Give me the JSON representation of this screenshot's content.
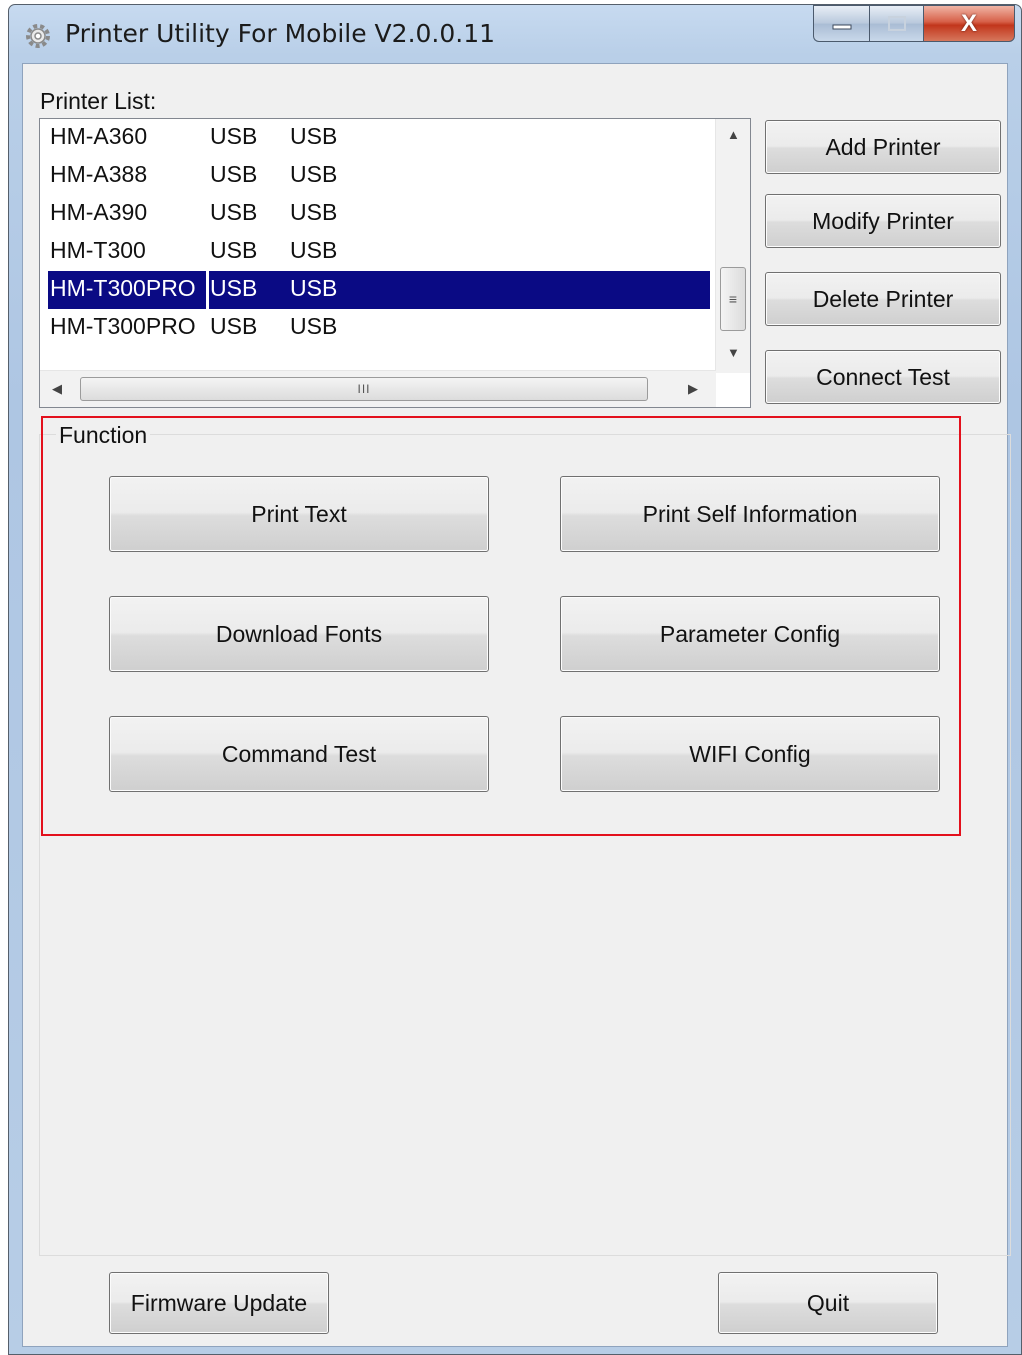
{
  "window": {
    "title": "Printer Utility For Mobile  V2.0.0.11",
    "caption_buttons": {
      "minimize_icon": "minimize-icon",
      "maximize_icon": "maximize-icon",
      "close_label": "X"
    }
  },
  "printer_list": {
    "label": "Printer List:",
    "rows": [
      {
        "name": "HM-A360",
        "col2": "USB",
        "col3": "USB"
      },
      {
        "name": "HM-A388",
        "col2": "USB",
        "col3": "USB"
      },
      {
        "name": "HM-A390",
        "col2": "USB",
        "col3": "USB"
      },
      {
        "name": "HM-T300",
        "col2": "USB",
        "col3": "USB"
      },
      {
        "name": "HM-T300PRO",
        "col2": "USB",
        "col3": "USB"
      },
      {
        "name": "HM-T300PRO",
        "col2": "USB",
        "col3": "USB"
      }
    ],
    "selected_index": 4,
    "scrollbar_h_grip": "III",
    "scrollbar_v_grip": "≡"
  },
  "printer_buttons": {
    "add": "Add Printer",
    "modify": "Modify Printer",
    "delete": "Delete Printer",
    "connect_test": "Connect Test"
  },
  "function": {
    "label": "Function",
    "print_text": "Print Text",
    "print_self_info": "Print Self Information",
    "download_fonts": "Download Fonts",
    "parameter_config": "Parameter Config",
    "command_test": "Command Test",
    "wifi_config": "WIFI Config"
  },
  "footer": {
    "firmware_update": "Firmware Update",
    "quit": "Quit"
  },
  "colors": {
    "selection": "#0a0a84",
    "highlight_border": "#e3101c",
    "titlebar": "#c7daf0"
  }
}
